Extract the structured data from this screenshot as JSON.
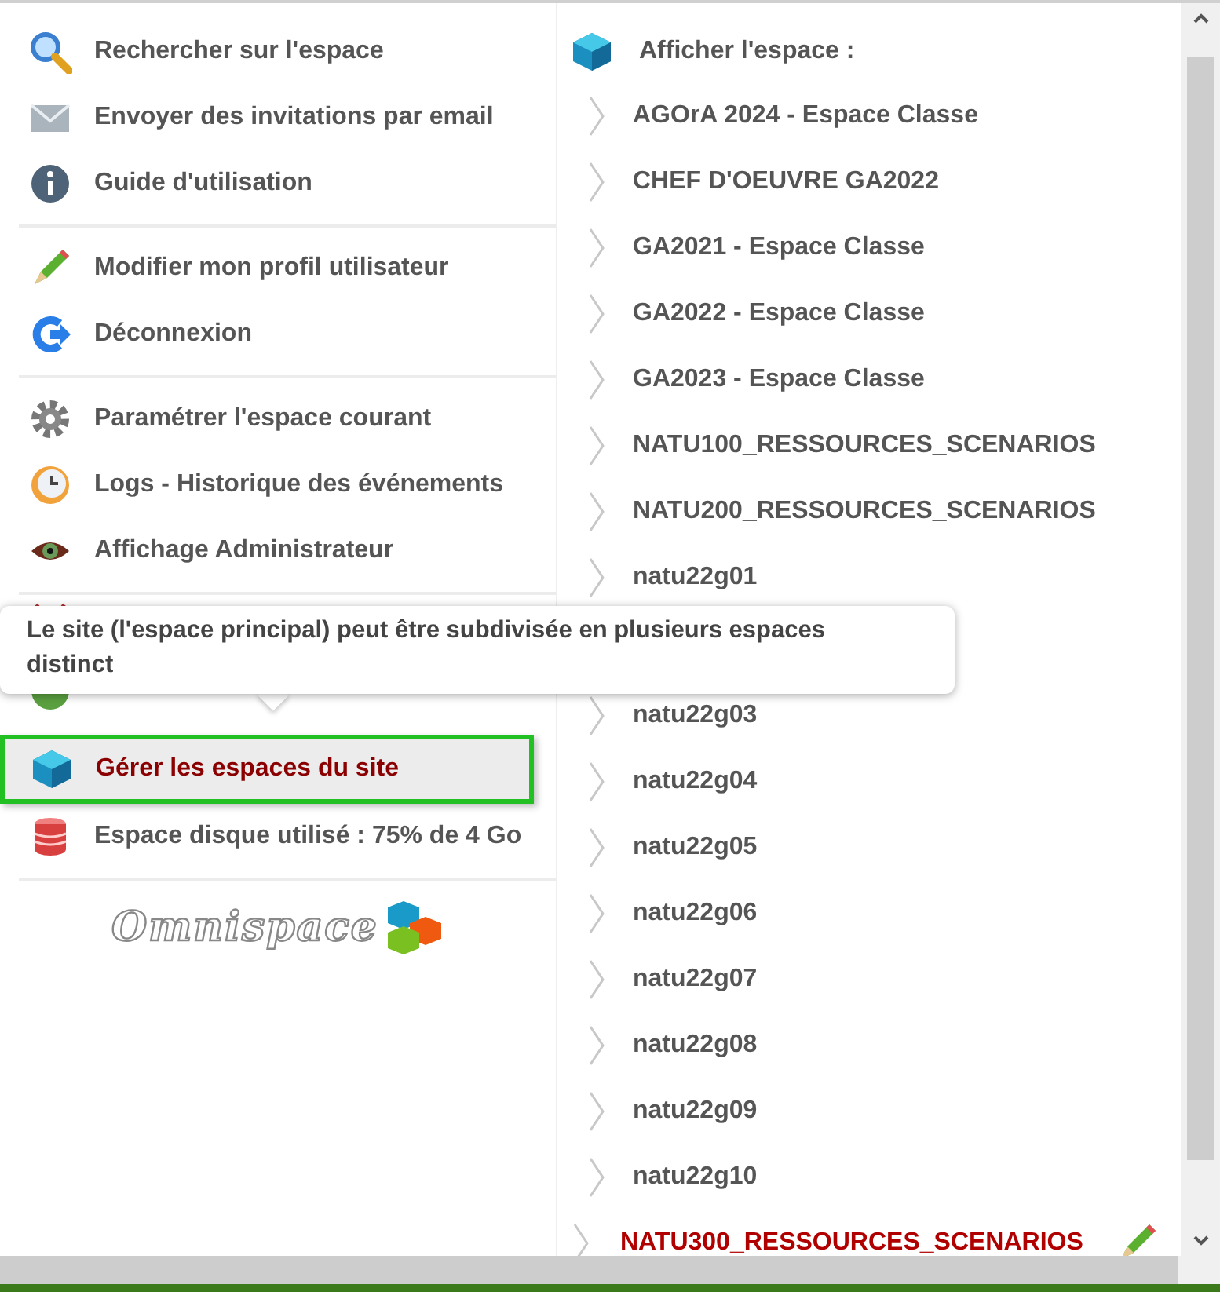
{
  "menu": {
    "groups": [
      [
        {
          "label": "Rechercher sur l'espace",
          "selected": false
        },
        {
          "label": "Envoyer des invitations par email",
          "selected": false
        },
        {
          "label": "Guide d'utilisation",
          "selected": false
        }
      ],
      [
        {
          "label": "Modifier mon profil utilisateur",
          "selected": false
        },
        {
          "label": "Déconnexion",
          "selected": false
        }
      ],
      [
        {
          "label": "Paramétrer l'espace courant",
          "selected": false
        },
        {
          "label": "Logs - Historique des événements",
          "selected": false
        },
        {
          "label": "Affichage Administrateur",
          "selected": false
        }
      ],
      [
        {
          "label": "Gérer les espaces du site",
          "selected": true
        },
        {
          "label": "Espace disque utilisé : 75% de 4 Go",
          "selected": false
        }
      ]
    ]
  },
  "tooltip": "Le site (l'espace principal) peut être subdivisée en plusieurs espaces distinct",
  "logo": "Omnispace",
  "spaces": {
    "header": "Afficher l'espace :",
    "items": [
      {
        "label": "AGOrA 2024 - Espace Classe",
        "selected": false
      },
      {
        "label": "CHEF D'OEUVRE GA2022",
        "selected": false
      },
      {
        "label": "GA2021 - Espace Classe",
        "selected": false
      },
      {
        "label": "GA2022 - Espace Classe",
        "selected": false
      },
      {
        "label": "GA2023 - Espace Classe",
        "selected": false
      },
      {
        "label": "NATU100_RESSOURCES_SCENARIOS",
        "selected": false
      },
      {
        "label": "NATU200_RESSOURCES_SCENARIOS",
        "selected": false
      },
      {
        "label": "natu22g01",
        "selected": false
      },
      {
        "label": "natu22g03",
        "selected": false
      },
      {
        "label": "natu22g04",
        "selected": false
      },
      {
        "label": "natu22g05",
        "selected": false
      },
      {
        "label": "natu22g06",
        "selected": false
      },
      {
        "label": "natu22g07",
        "selected": false
      },
      {
        "label": "natu22g08",
        "selected": false
      },
      {
        "label": "natu22g09",
        "selected": false
      },
      {
        "label": "natu22g10",
        "selected": false
      },
      {
        "label": "NATU300_RESSOURCES_SCENARIOS",
        "selected": true
      }
    ]
  }
}
